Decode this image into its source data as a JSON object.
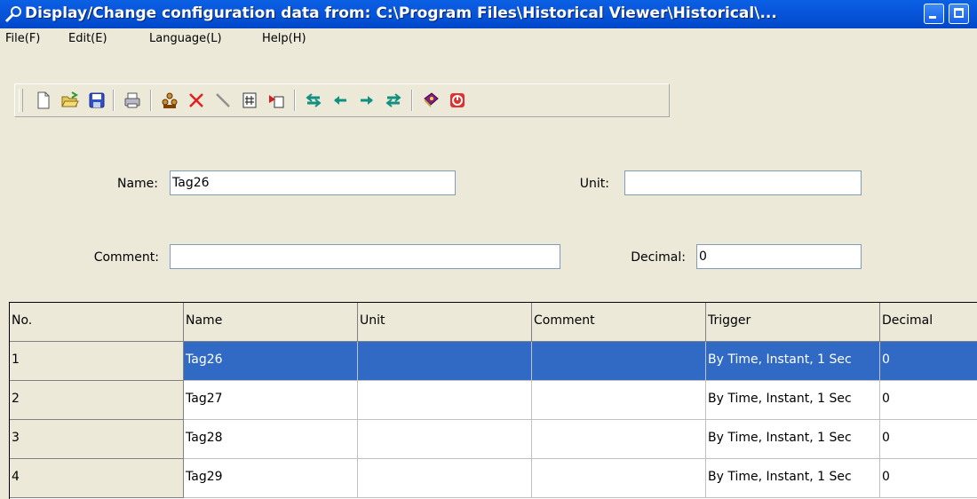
{
  "window": {
    "title": "Display/Change configuration data from: C:\\Program Files\\Historical Viewer\\Historical\\...",
    "title_color": "#0553d6"
  },
  "menu": [
    {
      "label": "File(F)"
    },
    {
      "label": "Edit(E)"
    },
    {
      "label": "Language(L)"
    },
    {
      "label": "Help(H)"
    }
  ],
  "toolbar": {
    "icons": [
      "new-file-icon",
      "open-folder-icon",
      "save-disk-icon",
      "print-icon",
      "tag-group-icon",
      "delete-x-icon",
      "line-tool-icon",
      "number-grid-icon",
      "import-icon",
      "move-first-icon",
      "move-prev-icon",
      "move-next-icon",
      "move-last-icon",
      "book-help-icon",
      "exit-power-icon"
    ]
  },
  "form": {
    "name_label": "Name:",
    "name_value": "Tag26",
    "unit_label": "Unit:",
    "unit_value": "",
    "comment_label": "Comment:",
    "comment_value": "",
    "decimal_label": "Decimal:",
    "decimal_value": "0"
  },
  "table": {
    "headers": [
      "No.",
      "Name",
      "Unit",
      "Comment",
      "Trigger",
      "Decimal"
    ],
    "rows": [
      {
        "no": "1",
        "name": "Tag26",
        "unit": "",
        "comment": "",
        "trigger": "By Time, Instant, 1 Sec",
        "decimal": "0",
        "selected": true
      },
      {
        "no": "2",
        "name": "Tag27",
        "unit": "",
        "comment": "",
        "trigger": "By Time, Instant, 1 Sec",
        "decimal": "0",
        "selected": false
      },
      {
        "no": "3",
        "name": "Tag28",
        "unit": "",
        "comment": "",
        "trigger": "By Time, Instant, 1 Sec",
        "decimal": "0",
        "selected": false
      },
      {
        "no": "4",
        "name": "Tag29",
        "unit": "",
        "comment": "",
        "trigger": "By Time, Instant, 1 Sec",
        "decimal": "0",
        "selected": false
      }
    ],
    "selection_color": "#316ac5"
  }
}
